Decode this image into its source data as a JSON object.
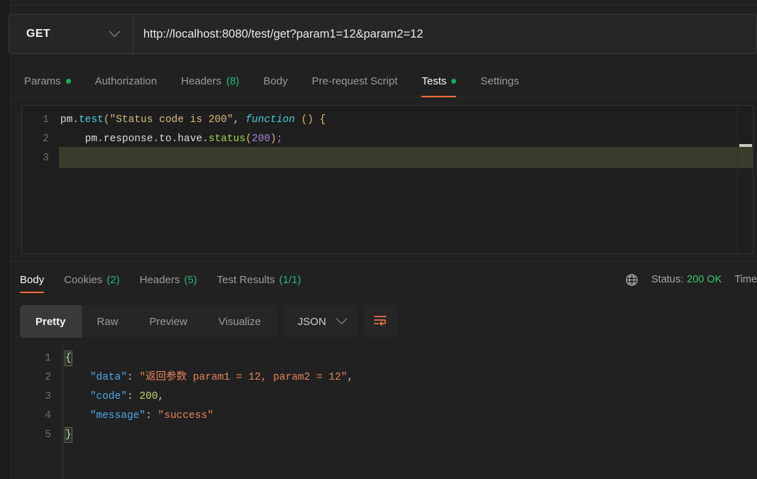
{
  "request": {
    "method": "GET",
    "method_icon": "chevron-down-icon",
    "url": "http://localhost:8080/test/get?param1=12&param2=12",
    "url_placeholder": "Enter request URL",
    "tabs": [
      {
        "label": "Params",
        "badge": "",
        "dot": true,
        "active": false
      },
      {
        "label": "Authorization",
        "badge": "",
        "dot": false,
        "active": false
      },
      {
        "label": "Headers",
        "badge": "(8)",
        "dot": false,
        "active": false
      },
      {
        "label": "Body",
        "badge": "",
        "dot": false,
        "active": false
      },
      {
        "label": "Pre-request Script",
        "badge": "",
        "dot": false,
        "active": false
      },
      {
        "label": "Tests",
        "badge": "",
        "dot": true,
        "active": true
      },
      {
        "label": "Settings",
        "badge": "",
        "dot": false,
        "active": false
      }
    ]
  },
  "tests_editor": {
    "line_numbers": [
      "1",
      "2",
      "3"
    ],
    "lines": [
      "pm.test(\"Status code is 200\", function () {",
      "    pm.response.to.have.status(200);",
      "});"
    ],
    "active_line": 3
  },
  "response": {
    "tabs": [
      {
        "label": "Body",
        "badge": "",
        "active": true
      },
      {
        "label": "Cookies",
        "badge": "(2)",
        "active": false
      },
      {
        "label": "Headers",
        "badge": "(5)",
        "active": false
      },
      {
        "label": "Test Results",
        "badge": "(1/1)",
        "active": false
      }
    ],
    "globe_icon": "globe-icon",
    "status_label": "Status:",
    "status_value": "200 OK",
    "time_label": "Time",
    "format_buttons": [
      {
        "label": "Pretty",
        "active": true
      },
      {
        "label": "Raw",
        "active": false
      },
      {
        "label": "Preview",
        "active": false
      },
      {
        "label": "Visualize",
        "active": false
      }
    ],
    "language_select": "JSON",
    "language_icon": "chevron-down-icon",
    "wrap_button_icon": "word-wrap-icon",
    "body_line_numbers": [
      "1",
      "2",
      "3",
      "4",
      "5"
    ],
    "body_json": {
      "data": "返回参数 param1 = 12, param2 = 12",
      "code": "200",
      "message": "success"
    }
  },
  "colors": {
    "accent": "#ff6c37",
    "success_green": "#2bb673",
    "status_green": "#36c46f",
    "json_key": "#4fa8e8",
    "json_string": "#e8825f",
    "json_number": "#c3d46a",
    "editor_bg": "#1e1e1e",
    "page_bg": "#212121"
  }
}
